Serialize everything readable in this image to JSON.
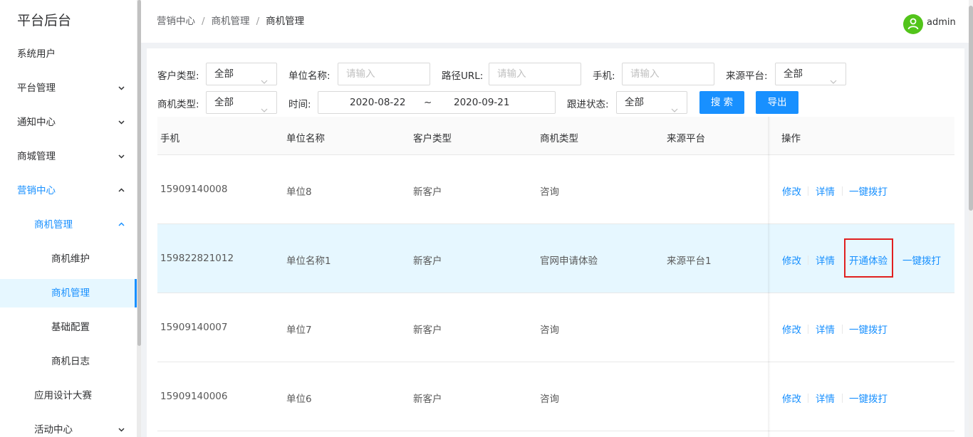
{
  "sidebar": {
    "brand": "平台后台",
    "items": [
      {
        "label": "系统用户"
      },
      {
        "label": "平台管理"
      },
      {
        "label": "通知中心"
      },
      {
        "label": "商城管理"
      },
      {
        "label": "营销中心"
      },
      {
        "label": "商机管理"
      },
      {
        "label": "商机维护"
      },
      {
        "label": "商机管理"
      },
      {
        "label": "基础配置"
      },
      {
        "label": "商机日志"
      },
      {
        "label": "应用设计大赛"
      },
      {
        "label": "活动中心"
      }
    ]
  },
  "header": {
    "breadcrumb": [
      "营销中心",
      "商机管理",
      "商机管理"
    ],
    "separator": "/",
    "user": "admin"
  },
  "filters": {
    "customer_type": {
      "label": "客户类型:",
      "value": "全部"
    },
    "company_name": {
      "label": "单位名称:",
      "placeholder": "请输入"
    },
    "path_url": {
      "label": "路径URL:",
      "placeholder": "请输入"
    },
    "phone": {
      "label": "手机:",
      "placeholder": "请输入"
    },
    "source_platform": {
      "label": "来源平台:",
      "value": "全部"
    },
    "opportunity_type": {
      "label": "商机类型:",
      "value": "全部"
    },
    "time": {
      "label": "时间:",
      "start": "2020-08-22",
      "tilde": "~",
      "end": "2020-09-21"
    },
    "follow_status": {
      "label": "跟进状态:",
      "value": "全部"
    },
    "search_button": "搜 索",
    "export_button": "导出"
  },
  "table": {
    "columns": [
      "手机",
      "单位名称",
      "客户类型",
      "商机类型",
      "来源平台",
      "操作"
    ],
    "rows": [
      {
        "phone": "15909140008",
        "company": "单位8",
        "customer_type": "新客户",
        "opp_type": "咨询",
        "source": "",
        "actions": [
          "修改",
          "详情",
          "一键拨打"
        ]
      },
      {
        "phone": "159822821012",
        "company": "单位名称1",
        "customer_type": "新客户",
        "opp_type": "官网申请体验",
        "source": "来源平台1",
        "actions": [
          "修改",
          "详情",
          "开通体验",
          "一键拨打"
        ]
      },
      {
        "phone": "15909140007",
        "company": "单位7",
        "customer_type": "新客户",
        "opp_type": "咨询",
        "source": "",
        "actions": [
          "修改",
          "详情",
          "一键拨打"
        ]
      },
      {
        "phone": "15909140006",
        "company": "单位6",
        "customer_type": "新客户",
        "opp_type": "咨询",
        "source": "",
        "actions": [
          "修改",
          "详情",
          "一键拨打"
        ]
      }
    ]
  },
  "colors": {
    "accent": "#1890ff",
    "highlight_row": "#e6f7ff",
    "avatar": "#52c41a",
    "annotation": "#e02020"
  },
  "icons": [
    "chevron-down-icon",
    "chevron-up-icon",
    "user-avatar-icon"
  ]
}
